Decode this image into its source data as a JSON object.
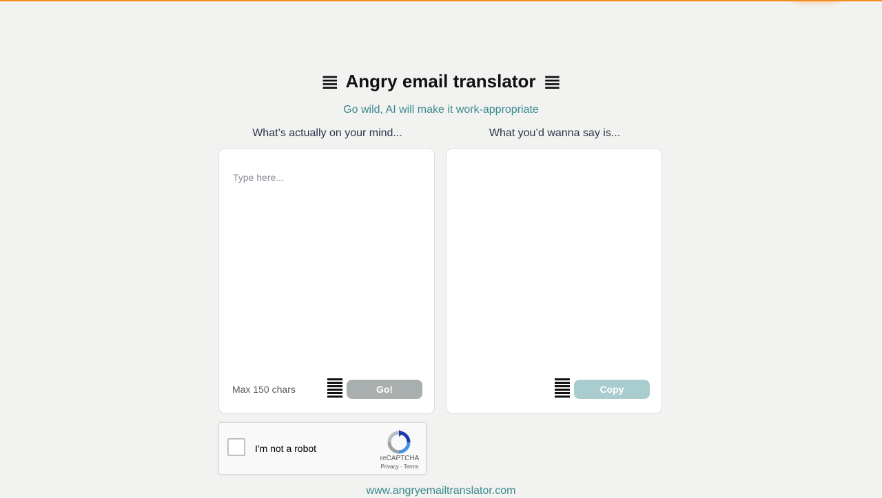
{
  "header": {
    "title": "Angry email translator",
    "title_icon": "bars-icon",
    "subtitle": "Go wild, AI will make it work-appropriate"
  },
  "input_panel": {
    "label": "What’s actually on your mind...",
    "value": "",
    "placeholder": "Type here...",
    "max_chars": "Max 150 chars",
    "go_button": "Go!"
  },
  "output_panel": {
    "label": "What you’d wanna say is...",
    "value": "",
    "copy_button": "Copy"
  },
  "recaptcha": {
    "label": "I'm not a robot",
    "brand": "reCAPTCHA",
    "privacy": "Privacy",
    "separator": "-",
    "terms": "Terms"
  },
  "footer": {
    "link": "www.angryemailtranslator.com"
  },
  "colors": {
    "accent_orange": "#f28c1c",
    "teal_text": "#3a8a8f",
    "go_button_bg": "#a9aeae",
    "copy_button_bg": "#a9cccf",
    "page_bg": "#f2f2f0"
  }
}
